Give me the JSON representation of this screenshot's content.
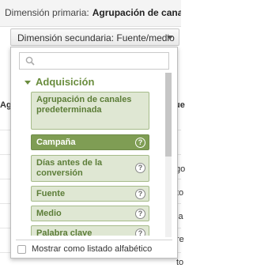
{
  "header": {
    "primary_label": "Dimensión primaria:",
    "primary_value": "Agrupación de canales M"
  },
  "background": {
    "left_col": "Ag",
    "right_col": "ue",
    "right_cells": [
      "go",
      "to",
      "ja",
      "re",
      "to",
      "os",
      "w",
      "o"
    ]
  },
  "secondary_dimension": {
    "button_label": "Dimensión secundaria: Fuente/medio",
    "search_placeholder": "",
    "group_label": "Adquisición",
    "items": [
      {
        "label": "Agrupación de canales predeterminada",
        "selected": false,
        "help": false
      },
      {
        "label": "Campaña",
        "selected": true,
        "help": true
      },
      {
        "label": "Días antes de la conversión",
        "selected": false,
        "help": true
      },
      {
        "label": "Fuente",
        "selected": false,
        "help": true
      },
      {
        "label": "Medio",
        "selected": false,
        "help": true
      },
      {
        "label": "Palabra clave",
        "selected": false,
        "help": true
      }
    ],
    "help_glyph": "?",
    "alphabetical_label": "Mostrar como listado alfabético",
    "alphabetical_checked": false
  },
  "colors": {
    "accent_green": "#6a8d3e",
    "item_bg": "#dfe7d3",
    "selected_bg": "#7f9d54"
  }
}
